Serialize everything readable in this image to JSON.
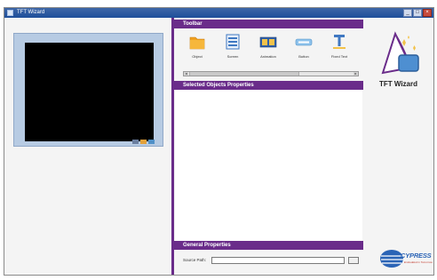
{
  "window": {
    "title": "TFT Wizard"
  },
  "toolbar": {
    "title": "Toolbar",
    "items": [
      {
        "label": "Object",
        "icon": "folder-icon"
      },
      {
        "label": "Screen",
        "icon": "screen-icon"
      },
      {
        "label": "Animation",
        "icon": "animation-icon"
      },
      {
        "label": "Button",
        "icon": "button-icon"
      },
      {
        "label": "Fixed Text",
        "icon": "fixed-text-icon"
      }
    ]
  },
  "properties": {
    "title": "Selected Objects Properties"
  },
  "general": {
    "title": "General Properties",
    "source_path_label": "Source Path:",
    "source_path_value": ""
  },
  "brand": {
    "name": "TFT Wizard",
    "company": "CYPRESS",
    "tagline": "Embedded in Tomorrow"
  },
  "colors": {
    "accent": "#6a2c8a",
    "preview_bg": "#b7cbe3",
    "title_bar": "#1d4e9a"
  }
}
